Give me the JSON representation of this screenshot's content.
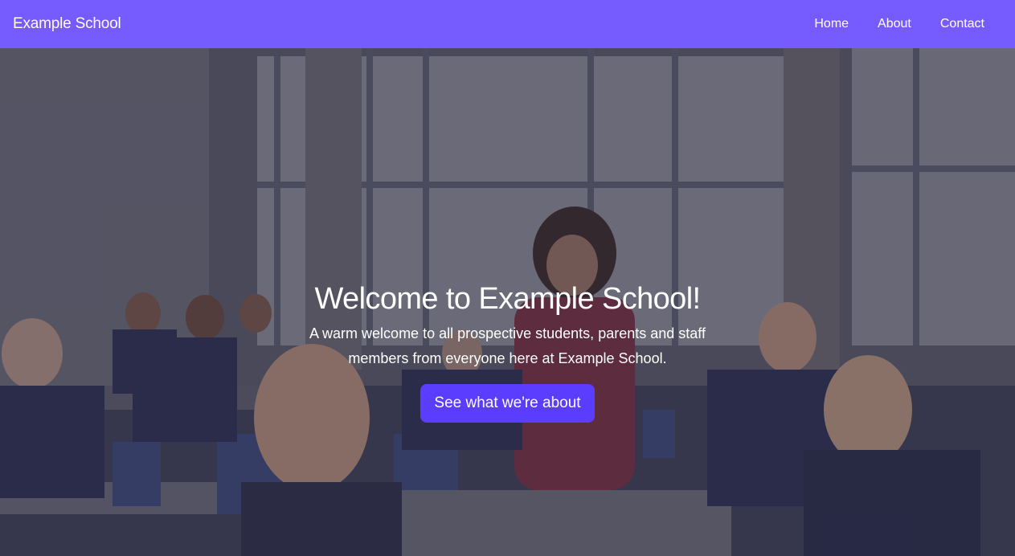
{
  "navbar": {
    "brand": "Example School",
    "links": [
      {
        "label": "Home"
      },
      {
        "label": "About"
      },
      {
        "label": "Contact"
      }
    ],
    "background": "#765cff"
  },
  "hero": {
    "title": "Welcome to Example School!",
    "subtitle": "A warm welcome to all prospective students, parents and staff members from everyone here at Example School.",
    "button_label": "See what we're about",
    "button_color": "#5a3dff"
  }
}
